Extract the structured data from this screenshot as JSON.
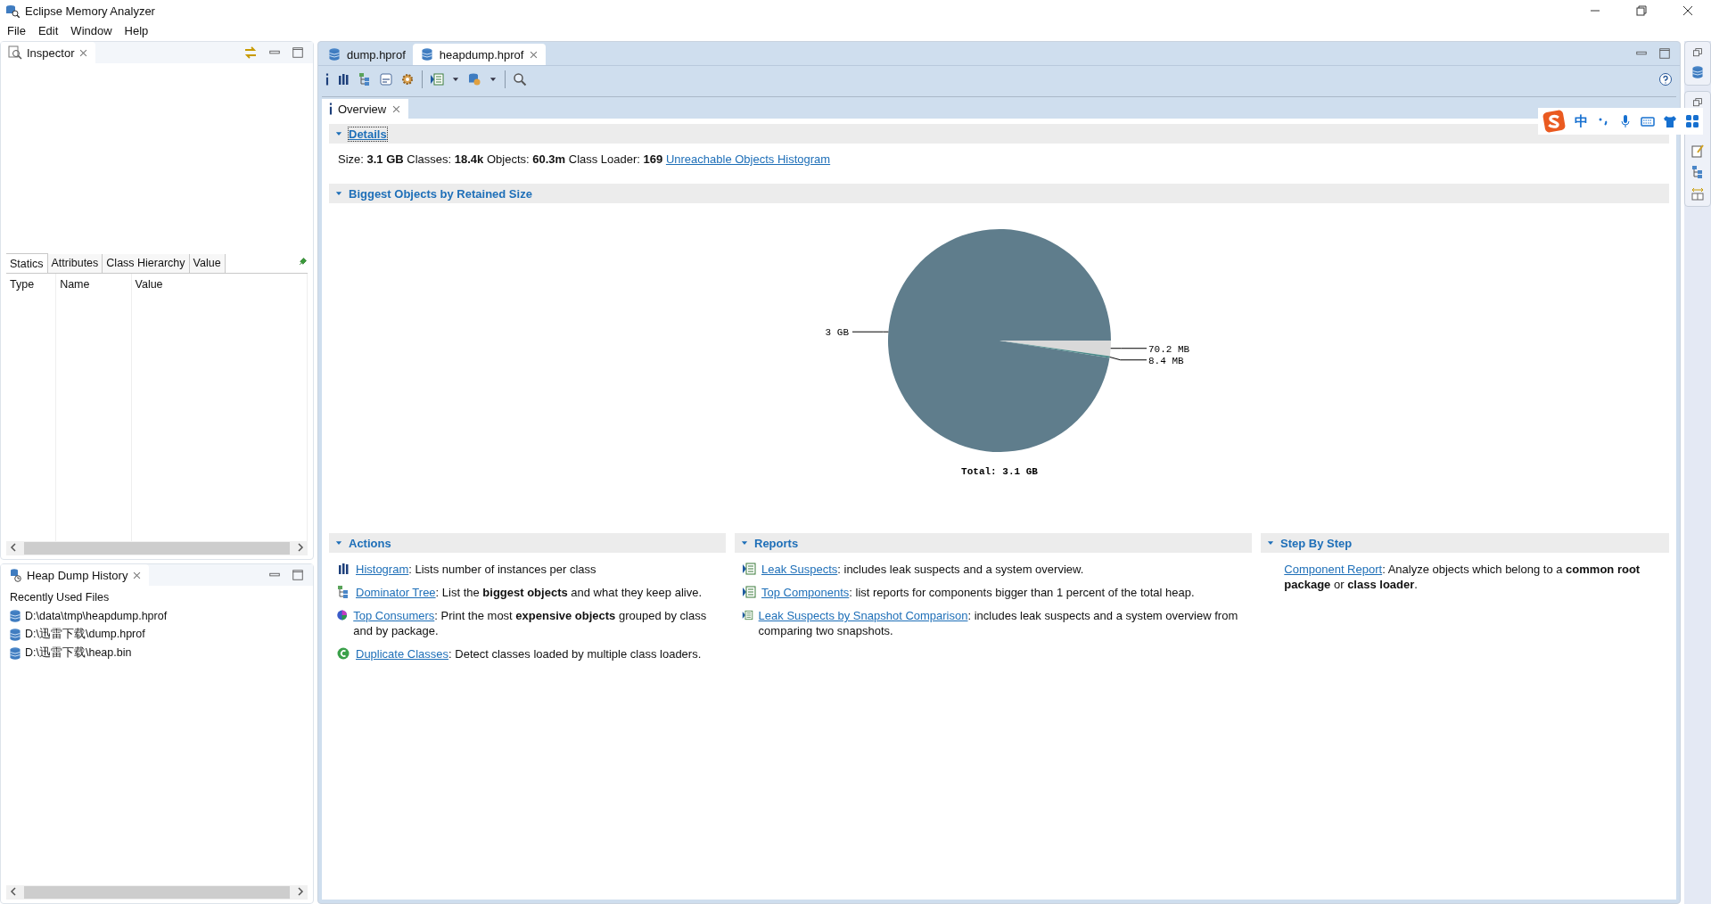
{
  "window": {
    "title": "Eclipse Memory Analyzer"
  },
  "menu": [
    "File",
    "Edit",
    "Window",
    "Help"
  ],
  "inspector": {
    "title": "Inspector",
    "tabs": [
      {
        "label": "Statics",
        "selected": true
      },
      {
        "label": "Attributes",
        "selected": false
      },
      {
        "label": "Class Hierarchy",
        "selected": false
      },
      {
        "label": "Value",
        "selected": false
      }
    ],
    "columns": [
      "Type",
      "Name",
      "Value"
    ]
  },
  "history": {
    "title": "Heap Dump History",
    "heading": "Recently Used Files",
    "files": [
      "D:\\data\\tmp\\heapdump.hprof",
      "D:\\迅雷下载\\dump.hprof",
      "D:\\迅雷下载\\heap.bin"
    ]
  },
  "editor_tabs": [
    {
      "label": "dump.hprof",
      "selected": false
    },
    {
      "label": "heapdump.hprof",
      "selected": true
    }
  ],
  "overview_tab": {
    "label": "Overview"
  },
  "details": {
    "title": "Details",
    "expanded": true,
    "summary": "Size: **3.1 GB** Classes: **18.4k** Objects: **60.3m** Class Loader: **169**",
    "link": "Unreachable Objects Histogram"
  },
  "biggest_objects": {
    "title": "Biggest Objects by Retained Size",
    "expanded": true,
    "chart_data": {
      "type": "pie",
      "title": "Total: 3.1 GB",
      "categories": [
        "3 GB",
        "70.2 MB",
        "8.4 MB"
      ],
      "series": [
        {
          "colors": [
            "#5f7d8c",
            "#d9d9d9",
            "#4b8a8a"
          ],
          "values": [
            3072,
            70.2,
            8.4
          ]
        }
      ]
    }
  },
  "actions": {
    "title": "Actions",
    "expanded": true,
    "items": [
      {
        "kind": "histogram",
        "link": "Histogram",
        "text": ": Lists number of instances per class"
      },
      {
        "kind": "tree",
        "link": "Dominator Tree",
        "text": ": List the **biggest objects** and what they keep alive."
      },
      {
        "kind": "consumers",
        "link": "Top Consumers",
        "text": ": Print the most **expensive objects** grouped by class and by package."
      },
      {
        "kind": "duplicates",
        "link": "Duplicate Classes",
        "text": ": Detect classes loaded by multiple class loaders."
      }
    ]
  },
  "reports": {
    "title": "Reports",
    "expanded": true,
    "items": [
      {
        "kind": "report",
        "link": "Leak Suspects",
        "text": ": includes leak suspects and a system overview."
      },
      {
        "kind": "report",
        "link": "Top Components",
        "text": ": list reports for components bigger than 1 percent of the total heap."
      },
      {
        "kind": "report",
        "link": "Leak Suspects by Snapshot Comparison",
        "text": ": includes leak suspects and a system overview from comparing two snapshots."
      }
    ]
  },
  "step_by_step": {
    "title": "Step By Step",
    "expanded": true,
    "items": [
      {
        "link": "Component Report",
        "text": ": Analyze objects which belong to a **common root package** or **class loader**."
      }
    ]
  },
  "ime_toolbar": {
    "mode": "中"
  }
}
